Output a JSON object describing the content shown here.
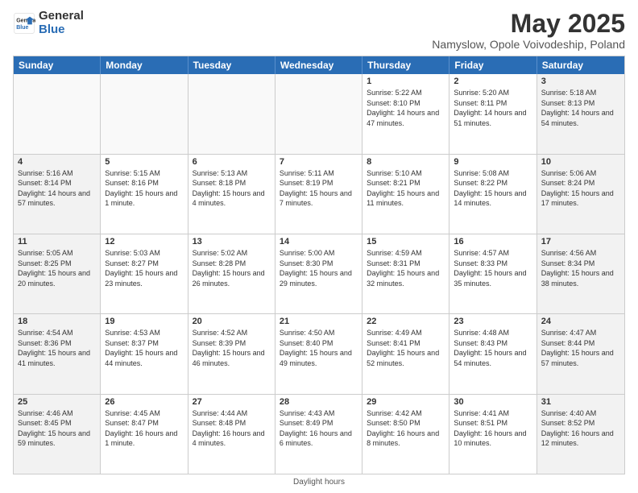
{
  "logo": {
    "general": "General",
    "blue": "Blue"
  },
  "title": "May 2025",
  "subtitle": "Namyslow, Opole Voivodeship, Poland",
  "days": [
    "Sunday",
    "Monday",
    "Tuesday",
    "Wednesday",
    "Thursday",
    "Friday",
    "Saturday"
  ],
  "weeks": [
    [
      {
        "day": "",
        "empty": true
      },
      {
        "day": "",
        "empty": true
      },
      {
        "day": "",
        "empty": true
      },
      {
        "day": "",
        "empty": true
      },
      {
        "day": "1",
        "sunrise": "5:22 AM",
        "sunset": "8:10 PM",
        "daylight": "14 hours and 47 minutes."
      },
      {
        "day": "2",
        "sunrise": "5:20 AM",
        "sunset": "8:11 PM",
        "daylight": "14 hours and 51 minutes."
      },
      {
        "day": "3",
        "sunrise": "5:18 AM",
        "sunset": "8:13 PM",
        "daylight": "14 hours and 54 minutes."
      }
    ],
    [
      {
        "day": "4",
        "sunrise": "5:16 AM",
        "sunset": "8:14 PM",
        "daylight": "14 hours and 57 minutes."
      },
      {
        "day": "5",
        "sunrise": "5:15 AM",
        "sunset": "8:16 PM",
        "daylight": "15 hours and 1 minute."
      },
      {
        "day": "6",
        "sunrise": "5:13 AM",
        "sunset": "8:18 PM",
        "daylight": "15 hours and 4 minutes."
      },
      {
        "day": "7",
        "sunrise": "5:11 AM",
        "sunset": "8:19 PM",
        "daylight": "15 hours and 7 minutes."
      },
      {
        "day": "8",
        "sunrise": "5:10 AM",
        "sunset": "8:21 PM",
        "daylight": "15 hours and 11 minutes."
      },
      {
        "day": "9",
        "sunrise": "5:08 AM",
        "sunset": "8:22 PM",
        "daylight": "15 hours and 14 minutes."
      },
      {
        "day": "10",
        "sunrise": "5:06 AM",
        "sunset": "8:24 PM",
        "daylight": "15 hours and 17 minutes."
      }
    ],
    [
      {
        "day": "11",
        "sunrise": "5:05 AM",
        "sunset": "8:25 PM",
        "daylight": "15 hours and 20 minutes."
      },
      {
        "day": "12",
        "sunrise": "5:03 AM",
        "sunset": "8:27 PM",
        "daylight": "15 hours and 23 minutes."
      },
      {
        "day": "13",
        "sunrise": "5:02 AM",
        "sunset": "8:28 PM",
        "daylight": "15 hours and 26 minutes."
      },
      {
        "day": "14",
        "sunrise": "5:00 AM",
        "sunset": "8:30 PM",
        "daylight": "15 hours and 29 minutes."
      },
      {
        "day": "15",
        "sunrise": "4:59 AM",
        "sunset": "8:31 PM",
        "daylight": "15 hours and 32 minutes."
      },
      {
        "day": "16",
        "sunrise": "4:57 AM",
        "sunset": "8:33 PM",
        "daylight": "15 hours and 35 minutes."
      },
      {
        "day": "17",
        "sunrise": "4:56 AM",
        "sunset": "8:34 PM",
        "daylight": "15 hours and 38 minutes."
      }
    ],
    [
      {
        "day": "18",
        "sunrise": "4:54 AM",
        "sunset": "8:36 PM",
        "daylight": "15 hours and 41 minutes."
      },
      {
        "day": "19",
        "sunrise": "4:53 AM",
        "sunset": "8:37 PM",
        "daylight": "15 hours and 44 minutes."
      },
      {
        "day": "20",
        "sunrise": "4:52 AM",
        "sunset": "8:39 PM",
        "daylight": "15 hours and 46 minutes."
      },
      {
        "day": "21",
        "sunrise": "4:50 AM",
        "sunset": "8:40 PM",
        "daylight": "15 hours and 49 minutes."
      },
      {
        "day": "22",
        "sunrise": "4:49 AM",
        "sunset": "8:41 PM",
        "daylight": "15 hours and 52 minutes."
      },
      {
        "day": "23",
        "sunrise": "4:48 AM",
        "sunset": "8:43 PM",
        "daylight": "15 hours and 54 minutes."
      },
      {
        "day": "24",
        "sunrise": "4:47 AM",
        "sunset": "8:44 PM",
        "daylight": "15 hours and 57 minutes."
      }
    ],
    [
      {
        "day": "25",
        "sunrise": "4:46 AM",
        "sunset": "8:45 PM",
        "daylight": "15 hours and 59 minutes."
      },
      {
        "day": "26",
        "sunrise": "4:45 AM",
        "sunset": "8:47 PM",
        "daylight": "16 hours and 1 minute."
      },
      {
        "day": "27",
        "sunrise": "4:44 AM",
        "sunset": "8:48 PM",
        "daylight": "16 hours and 4 minutes."
      },
      {
        "day": "28",
        "sunrise": "4:43 AM",
        "sunset": "8:49 PM",
        "daylight": "16 hours and 6 minutes."
      },
      {
        "day": "29",
        "sunrise": "4:42 AM",
        "sunset": "8:50 PM",
        "daylight": "16 hours and 8 minutes."
      },
      {
        "day": "30",
        "sunrise": "4:41 AM",
        "sunset": "8:51 PM",
        "daylight": "16 hours and 10 minutes."
      },
      {
        "day": "31",
        "sunrise": "4:40 AM",
        "sunset": "8:52 PM",
        "daylight": "16 hours and 12 minutes."
      }
    ]
  ],
  "footer": "Daylight hours"
}
